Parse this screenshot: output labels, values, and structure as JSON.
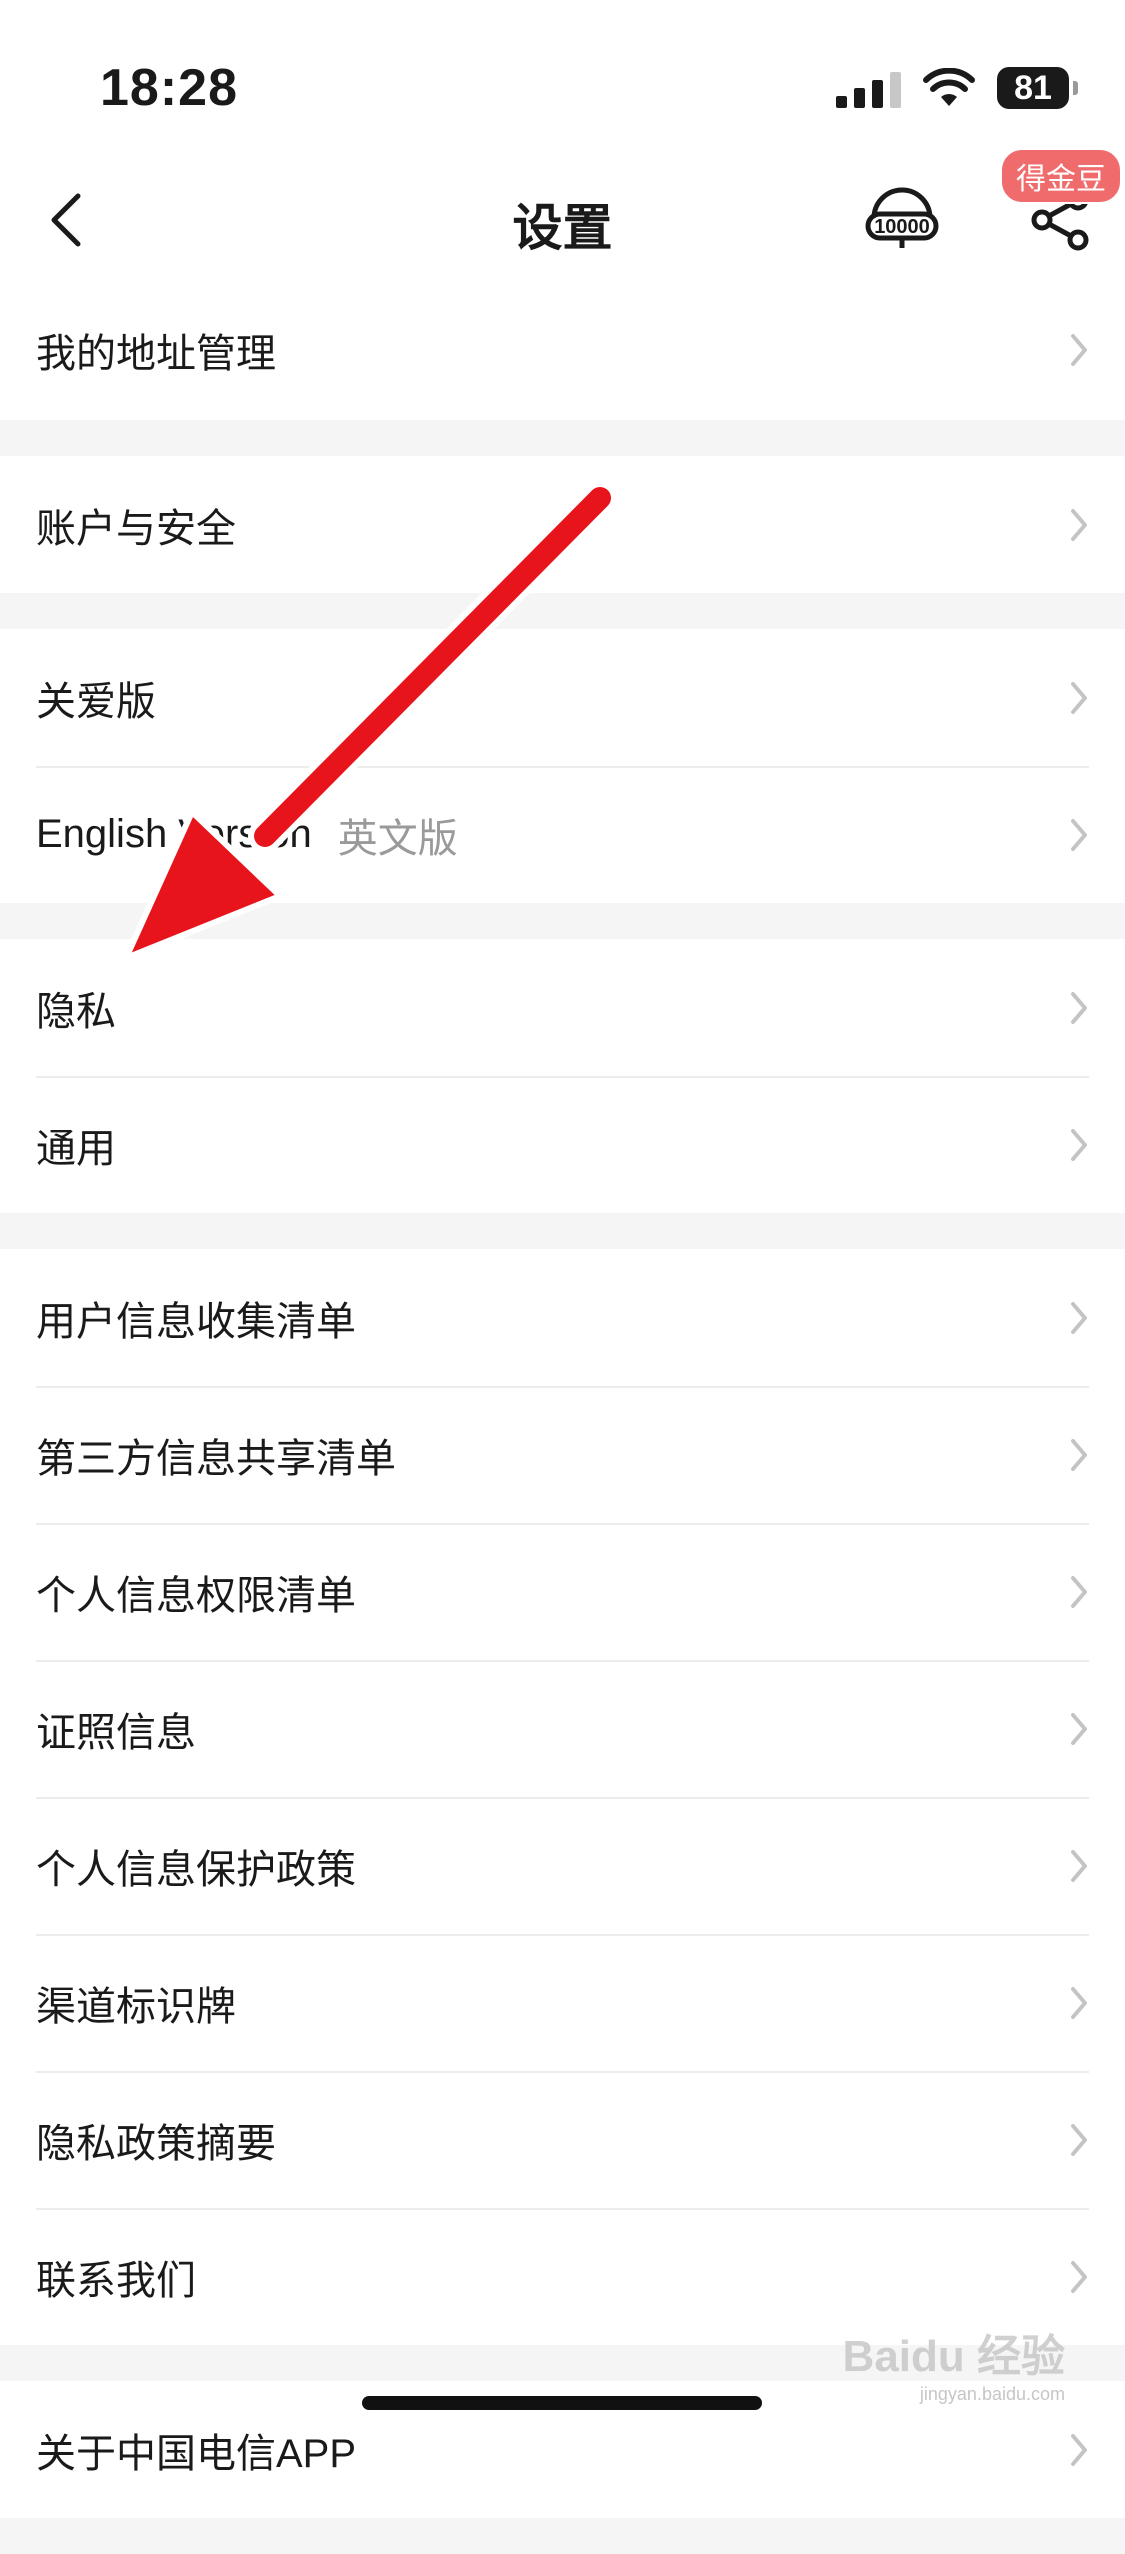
{
  "status_bar": {
    "time": "18:28",
    "battery": "81"
  },
  "navbar": {
    "title": "设置",
    "badge": "得金豆"
  },
  "groups": [
    {
      "items": [
        {
          "label": "我的地址管理"
        }
      ]
    },
    {
      "items": [
        {
          "label": "账户与安全"
        }
      ]
    },
    {
      "items": [
        {
          "label": "关爱版"
        },
        {
          "label": "English Version",
          "sub": "英文版"
        }
      ]
    },
    {
      "items": [
        {
          "label": "隐私"
        },
        {
          "label": "通用"
        }
      ]
    },
    {
      "items": [
        {
          "label": "用户信息收集清单"
        },
        {
          "label": "第三方信息共享清单"
        },
        {
          "label": "个人信息权限清单"
        },
        {
          "label": "证照信息"
        },
        {
          "label": "个人信息保护政策"
        },
        {
          "label": "渠道标识牌"
        },
        {
          "label": "隐私政策摘要"
        },
        {
          "label": "联系我们"
        }
      ]
    },
    {
      "items": [
        {
          "label": "关于中国电信APP"
        }
      ]
    }
  ],
  "watermark": {
    "brand": "Baidu 经验",
    "url": "jingyan.baidu.com"
  },
  "colors": {
    "accent": "#e8141c",
    "badge": "#f06b6b"
  }
}
